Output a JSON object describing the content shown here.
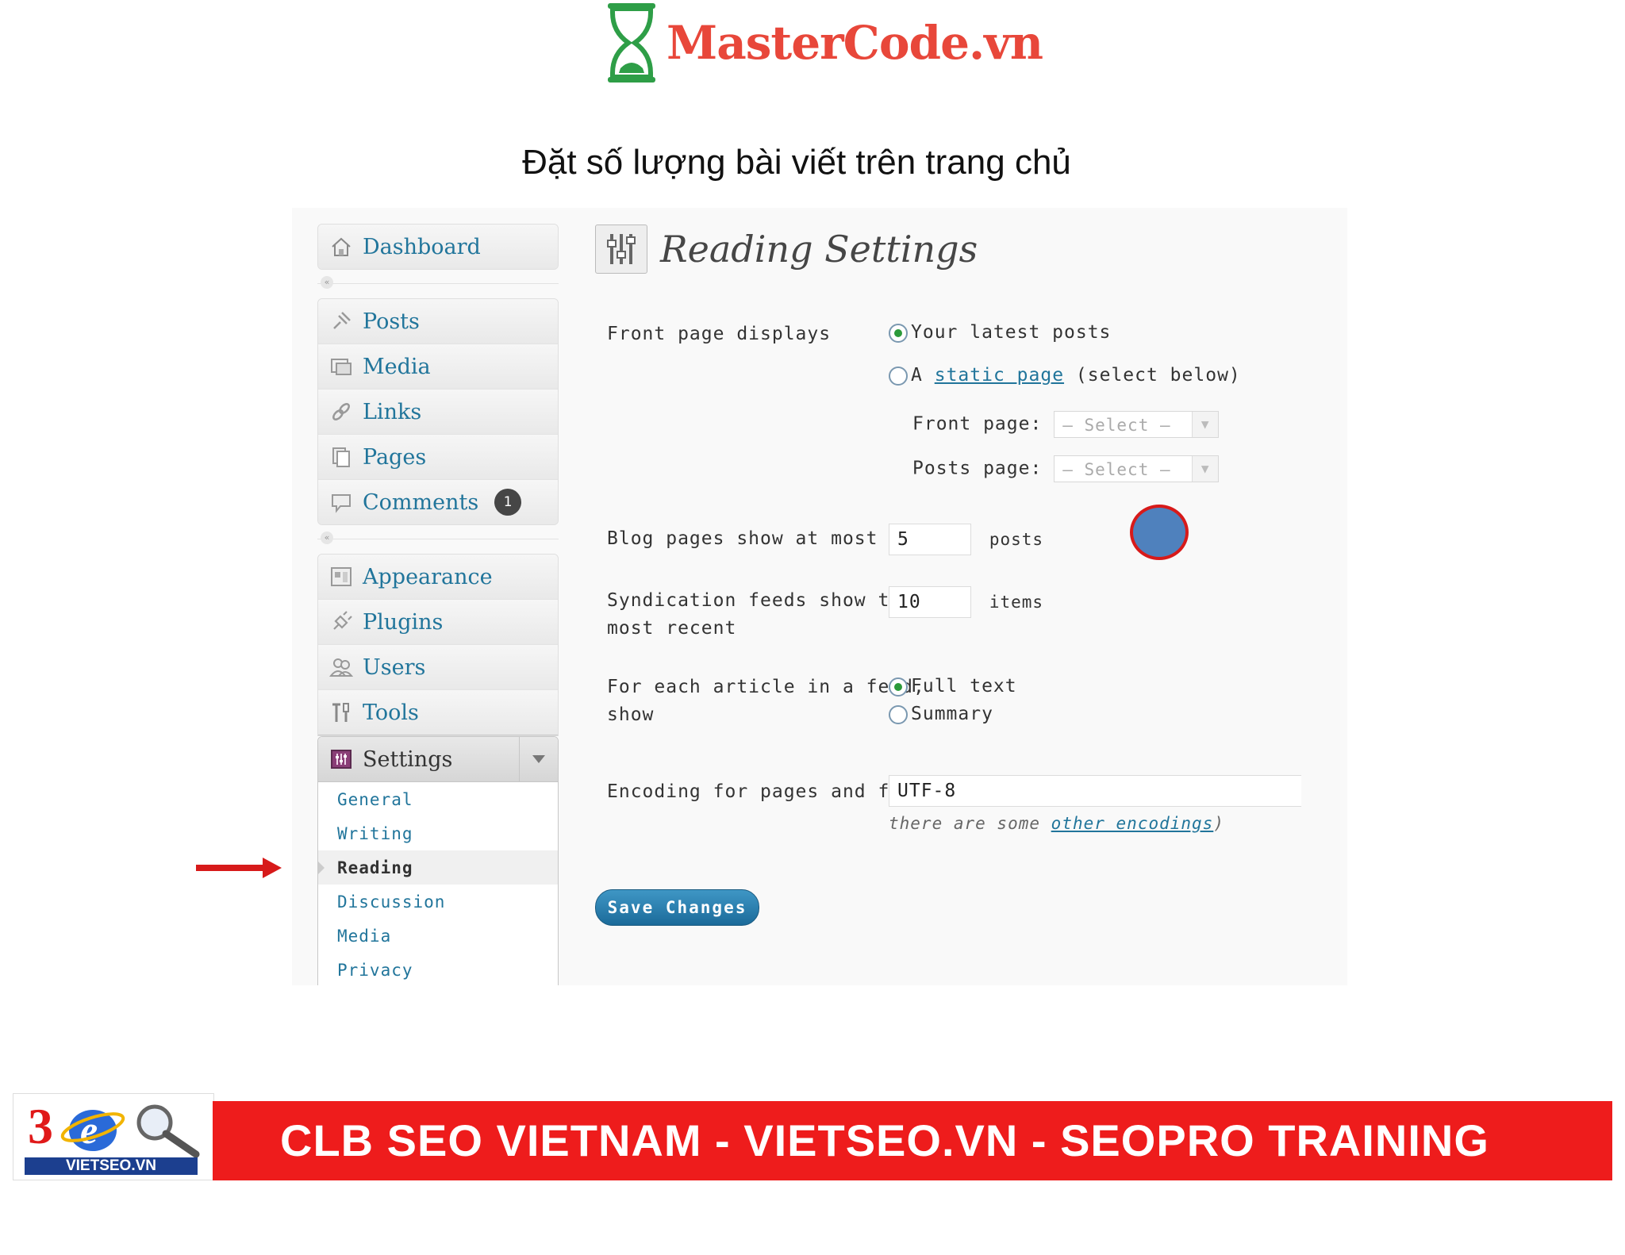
{
  "brand": {
    "name": "MasterCode.vn"
  },
  "slide": {
    "title": "Đặt số lượng bài viết trên trang chủ"
  },
  "menu": {
    "dashboard": "Dashboard",
    "items": [
      {
        "label": "Posts",
        "icon": "pin-icon"
      },
      {
        "label": "Media",
        "icon": "media-icon"
      },
      {
        "label": "Links",
        "icon": "link-icon"
      },
      {
        "label": "Pages",
        "icon": "pages-icon"
      },
      {
        "label": "Comments",
        "icon": "comment-icon",
        "badge": "1"
      }
    ],
    "items2": [
      {
        "label": "Appearance",
        "icon": "appearance-icon"
      },
      {
        "label": "Plugins",
        "icon": "plugin-icon"
      },
      {
        "label": "Users",
        "icon": "users-icon"
      },
      {
        "label": "Tools",
        "icon": "tools-icon"
      }
    ],
    "settings": {
      "label": "Settings",
      "submenu": [
        "General",
        "Writing",
        "Reading",
        "Discussion",
        "Media",
        "Privacy"
      ],
      "current": "Reading"
    }
  },
  "page": {
    "title": "Reading Settings",
    "front_page_displays": {
      "label": "Front page displays",
      "option_latest": "Your latest posts",
      "option_static_prefix": "A",
      "option_static_link": "static page",
      "option_static_suffix": "(select below)",
      "selected": "latest",
      "front_page_label": "Front page:",
      "posts_page_label": "Posts page:",
      "select_placeholder": "— Select —"
    },
    "blog_pages": {
      "label": "Blog pages show at most",
      "value": "5",
      "unit": "posts"
    },
    "syndication": {
      "label_line1": "Syndication feeds show the",
      "label_line2": "most recent",
      "value": "10",
      "unit": "items"
    },
    "feed_article": {
      "label_line1": "For each article in a feed,",
      "label_line2": "show",
      "option_full": "Full text",
      "option_summary": "Summary",
      "selected": "full"
    },
    "encoding": {
      "label": "Encoding for pages and feeds",
      "value": "UTF-8",
      "hint_prefix": "there are some",
      "hint_link": "other encodings",
      "hint_suffix": ")"
    },
    "save_button": "Save Changes"
  },
  "footer": {
    "logo_text": "VIETSEO.VN",
    "banner": "CLB SEO VIETNAM - VIETSEO.VN - SEOPRO TRAINING"
  },
  "colors": {
    "link": "#21759b",
    "highlight_circle": "#4f81bd",
    "circle_border": "#d71a1a",
    "banner": "#ee1c1c"
  }
}
